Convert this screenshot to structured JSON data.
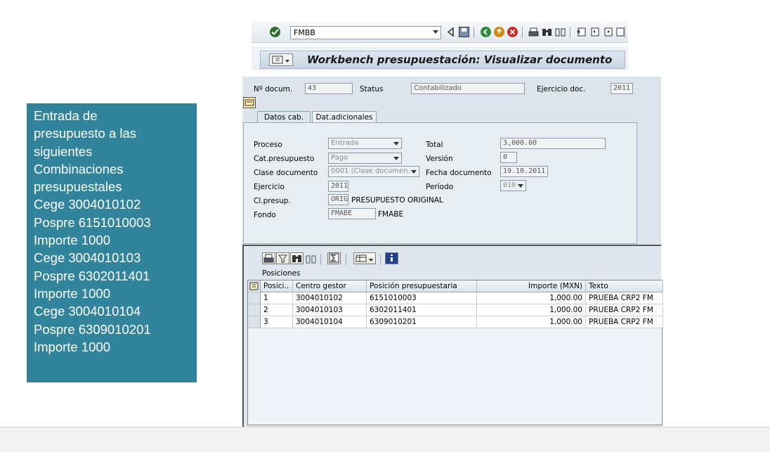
{
  "info_box": {
    "lines": [
      "Entrada de",
      "presupuesto a las",
      "siguientes",
      "Combinaciones",
      "presupuestales",
      "Cege 3004010102",
      "Pospre 6151010003",
      "Importe  1000",
      "Cege 3004010103",
      "Pospre 6302011401",
      "Importe  1000",
      "Cege 3004010104",
      "Pospre 6309010201",
      "Importe  1000"
    ]
  },
  "toolbar": {
    "command_value": "FMBB"
  },
  "title": "Workbench presupuestación: Visualizar documento",
  "header": {
    "doc_label": "Nº docum.",
    "doc_value": "43",
    "status_label": "Status",
    "status_value": "Contabilizado",
    "ejercicio_doc_label": "Ejercicio doc.",
    "ejercicio_doc_value": "2011"
  },
  "tabs": [
    "Datos cab.",
    "Dat.adicionales"
  ],
  "form": {
    "proceso_label": "Proceso",
    "proceso_value": "Entrada",
    "catpres_label": "Cat.presupuesto",
    "catpres_value": "Pago",
    "clasedoc_label": "Clase documento",
    "clasedoc_value": "0001 (Clase documen...",
    "ejercicio_label": "Ejercicio",
    "ejercicio_value": "2011",
    "clpresup_label": "Cl.presup.",
    "clpresup_value": "ORIG",
    "clpresup_desc": "PRESUPUESTO ORIGINAL",
    "fondo_label": "Fondo",
    "fondo_value": "FMABE",
    "fondo_desc": "FMABE",
    "total_label": "Total",
    "total_value": "3,000.00",
    "version_label": "Versión",
    "version_value": "0",
    "fechadoc_label": "Fecha documento",
    "fechadoc_value": "19.10.2011",
    "periodo_label": "Período",
    "periodo_value": "010"
  },
  "positions": {
    "title": "Posiciones",
    "headers": [
      "Posici..",
      "Centro gestor",
      "Posición presupuestaria",
      "Importe (MXN)",
      "Texto"
    ],
    "rows": [
      [
        "1",
        "3004010102",
        "6151010003",
        "1,000.00",
        "PRUEBA CRP2 FM"
      ],
      [
        "2",
        "3004010103",
        "6302011401",
        "1,000.00",
        "PRUEBA CRP2 FM"
      ],
      [
        "3",
        "3004010104",
        "6309010201",
        "1,000.00",
        "PRUEBA CRP2 FM"
      ]
    ]
  },
  "colors": {
    "info_box": "#31849b",
    "sap_bg": "#dde4ec"
  }
}
